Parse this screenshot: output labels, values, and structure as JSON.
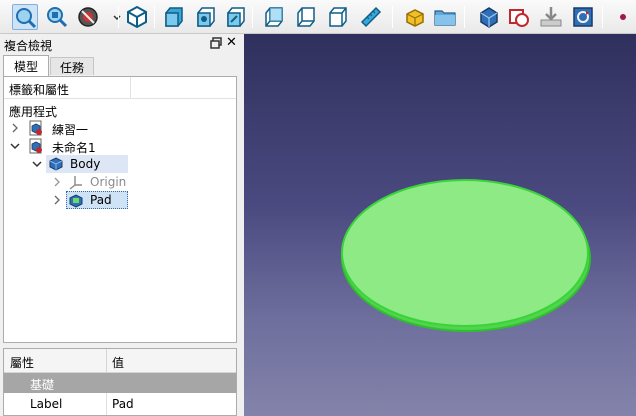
{
  "toolbar": {
    "icons": [
      "fit-all-icon",
      "fit-selection-icon",
      "draw-style-icon",
      "isometric-view-icon",
      "front-view-icon",
      "top-view-icon",
      "right-view-icon",
      "rear-view-icon",
      "bottom-view-icon",
      "left-view-icon",
      "measure-icon",
      "new-part-icon",
      "open-folder-icon",
      "create-body-icon",
      "create-sketch-icon",
      "import-icon",
      "refresh-icon",
      "point-icon"
    ]
  },
  "panel": {
    "title": "複合檢視",
    "tabs": [
      {
        "label": "模型"
      },
      {
        "label": "任務"
      }
    ],
    "tree_header": "標籤和屬性",
    "tree": [
      {
        "label": "應用程式",
        "icon": "none"
      },
      {
        "label": "練習一",
        "icon": "document-icon",
        "chevron": "right"
      },
      {
        "label": "未命名1",
        "icon": "document-icon",
        "chevron": "down"
      },
      {
        "label": "Body",
        "icon": "body-icon",
        "chevron": "down"
      },
      {
        "label": "Origin",
        "icon": "origin-icon",
        "chevron": "right"
      },
      {
        "label": "Pad",
        "icon": "pad-icon",
        "chevron": "right"
      }
    ]
  },
  "properties": {
    "col_property": "屬性",
    "col_value": "值",
    "group": "基礎",
    "row_label": "Label",
    "row_value": "Pad"
  },
  "colors": {
    "pad_fill": "#8eea84",
    "pad_edge": "#3bd33b",
    "viewport_top": "#30305e",
    "viewport_bottom": "#8383aa",
    "selection": "#cfe3f7"
  }
}
